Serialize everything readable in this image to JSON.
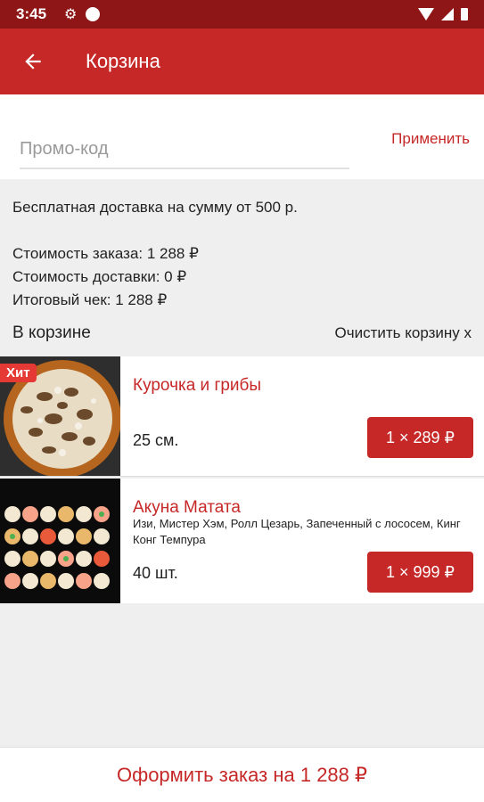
{
  "status_bar": {
    "time": "3:45"
  },
  "app_bar": {
    "title": "Корзина"
  },
  "promo": {
    "placeholder": "Промо-код",
    "apply_label": "Применить"
  },
  "summary": {
    "free_delivery": "Бесплатная доставка на сумму от 500 р.",
    "order_cost": "Стоимость заказа: 1 288 ₽",
    "delivery_cost": "Стоимость доставки: 0 ₽",
    "total": "Итоговый чек: 1 288 ₽"
  },
  "cart": {
    "title": "В корзине",
    "clear_label": "Очистить корзину х",
    "items": [
      {
        "name": "Курочка и грибы",
        "badge": "Хит",
        "description": "",
        "size": "25 см.",
        "price_label": "1 × 289 ₽"
      },
      {
        "name": "Акуна Матата",
        "badge": "",
        "description": "Изи, Мистер Хэм, Ролл Цезарь, Запеченный с лососем, Кинг Конг Темпура",
        "size": "40 шт.",
        "price_label": "1 × 999 ₽"
      }
    ]
  },
  "checkout": {
    "label": "Оформить заказ на 1 288 ₽"
  },
  "colors": {
    "primary": "#c62828",
    "status_bar": "#8e1616",
    "background": "#efefef"
  }
}
